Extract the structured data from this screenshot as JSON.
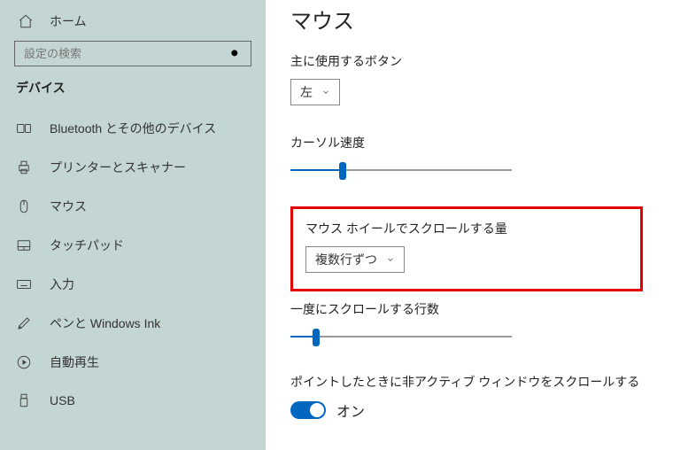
{
  "sidebar": {
    "home": "ホーム",
    "search_placeholder": "設定の検索",
    "section": "デバイス",
    "items": [
      {
        "label": "Bluetooth とその他のデバイス",
        "icon": "bluetooth-devices-icon"
      },
      {
        "label": "プリンターとスキャナー",
        "icon": "printer-icon"
      },
      {
        "label": "マウス",
        "icon": "mouse-icon"
      },
      {
        "label": "タッチパッド",
        "icon": "touchpad-icon"
      },
      {
        "label": "入力",
        "icon": "keyboard-icon"
      },
      {
        "label": "ペンと Windows Ink",
        "icon": "pen-icon"
      },
      {
        "label": "自動再生",
        "icon": "autoplay-icon"
      },
      {
        "label": "USB",
        "icon": "usb-icon"
      }
    ]
  },
  "main": {
    "title": "マウス",
    "primary_button_label": "主に使用するボタン",
    "primary_button_value": "左",
    "cursor_speed_label": "カーソル速度",
    "cursor_speed_percent": 22,
    "scroll_amount_label": "マウス ホイールでスクロールする量",
    "scroll_amount_value": "複数行ずつ",
    "lines_label": "一度にスクロールする行数",
    "lines_percent": 10,
    "inactive_label": "ポイントしたときに非アクティブ ウィンドウをスクロールする",
    "inactive_value": "オン"
  }
}
